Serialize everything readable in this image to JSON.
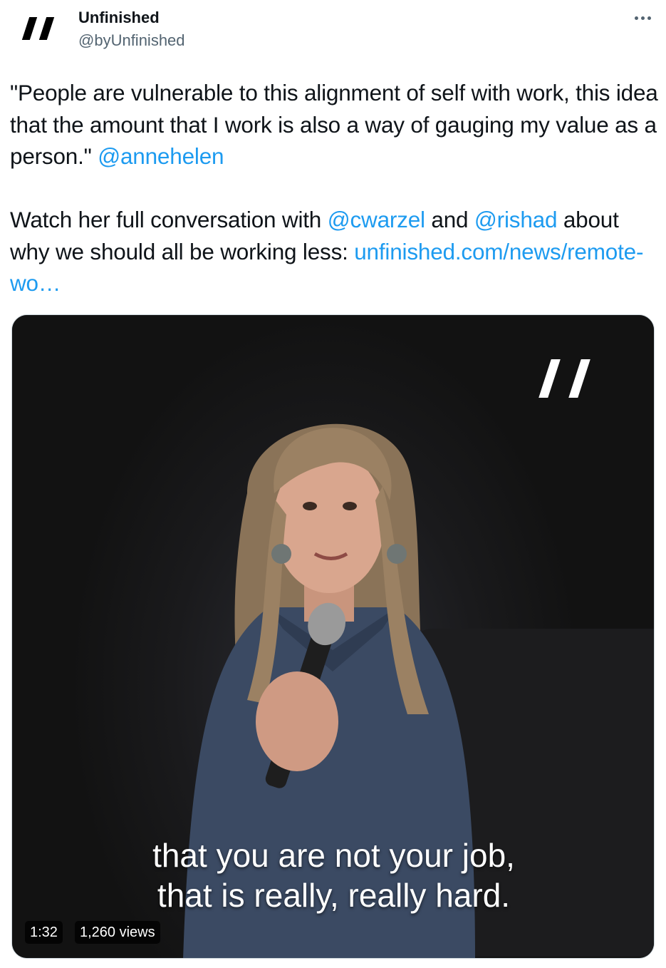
{
  "author": {
    "name": "Unfinished",
    "handle": "@byUnfinished",
    "avatar_icon": "unfinished-logo-icon"
  },
  "more_icon": "more-options-icon",
  "tweet": {
    "para1_text": "\"People are vulnerable to this alignment of self with work, this idea that the amount that I work is also a way of gauging my value as a person.\" ",
    "mention1": "@annehelen",
    "para2_text_a": "Watch her full conversation with ",
    "mention2": "@cwarzel",
    "para2_text_b": " and ",
    "mention3": "@rishad",
    "para2_text_c": " about why we should all be working less: ",
    "link": "unfinished.com/news/remote-wo…"
  },
  "video": {
    "caption_line1": "that you are not your job,",
    "caption_line2": "that is really, really hard.",
    "duration": "1:32",
    "views": "1,260 views",
    "watermark_icon": "unfinished-watermark-icon"
  },
  "colors": {
    "link": "#1d9bf0",
    "text": "#0f1419",
    "secondary": "#536471"
  }
}
